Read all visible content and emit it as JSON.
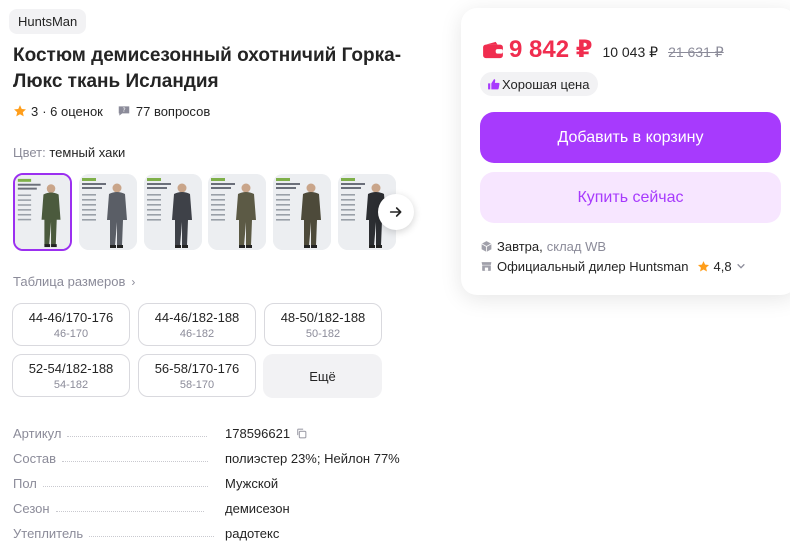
{
  "brand": "HuntsMan",
  "title": "Костюм демисезонный охотничий Горка-Люкс ткань Исландия",
  "rating": {
    "score": "3",
    "reviews": "· 6 оценок",
    "questions": "77 вопросов"
  },
  "color": {
    "label": "Цвет:",
    "value": "темный хаки"
  },
  "thumbnails": [
    {
      "suit": "#4b5a3d",
      "selected": true
    },
    {
      "suit": "#5a5e66",
      "selected": false
    },
    {
      "suit": "#3e4148",
      "selected": false
    },
    {
      "suit": "#5c5a45",
      "selected": false
    },
    {
      "suit": "#4d4a3a",
      "selected": false
    },
    {
      "suit": "#2c2e32",
      "selected": false
    }
  ],
  "size_table_link": "Таблица размеров",
  "sizes": [
    {
      "main": "44-46/170-176",
      "sub": "46-170"
    },
    {
      "main": "44-46/182-188",
      "sub": "46-182"
    },
    {
      "main": "48-50/182-188",
      "sub": "50-182"
    },
    {
      "main": "52-54/182-188",
      "sub": "54-182"
    },
    {
      "main": "56-58/170-176",
      "sub": "58-170"
    }
  ],
  "more_label": "Ещё",
  "specs": [
    {
      "key": "Артикул",
      "value": "178596621"
    },
    {
      "key": "Состав",
      "value": "полиэстер 23%; Нейлон 77%"
    },
    {
      "key": "Пол",
      "value": "Мужской"
    },
    {
      "key": "Сезон",
      "value": "демисезон"
    },
    {
      "key": "Утеплитель",
      "value": "радотекс"
    }
  ],
  "card": {
    "price_main": "9 842 ₽",
    "price_old": "10 043 ₽",
    "price_strike": "21 631 ₽",
    "badge": "Хорошая цена",
    "add_to_cart": "Добавить в корзину",
    "buy_now": "Купить сейчас",
    "delivery_day": "Завтра,",
    "delivery_place": "склад WB",
    "dealer": "Официальный дилер Huntsman",
    "dealer_rating": "4,8"
  },
  "colors": {
    "accent": "#a73afd",
    "price": "#f02d4f",
    "light_accent": "#f7e6ff"
  }
}
